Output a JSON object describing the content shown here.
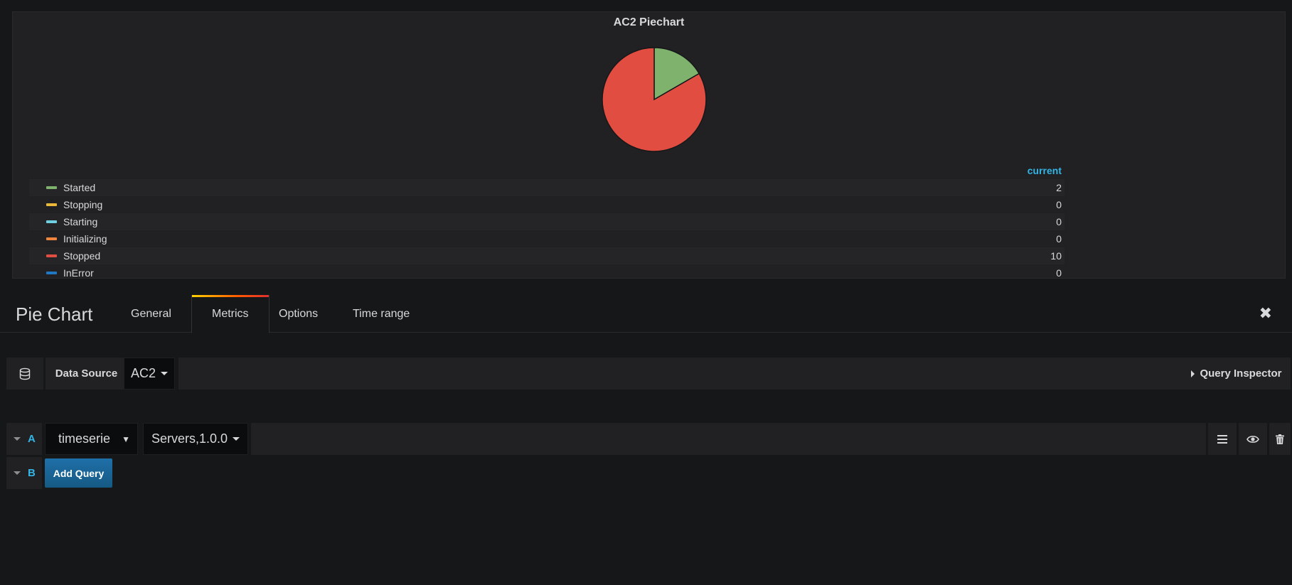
{
  "panel": {
    "title": "AC2 Piechart",
    "legend_header": "current"
  },
  "chart_data": {
    "type": "pie",
    "title": "AC2 Piechart",
    "slices": [
      {
        "name": "Started",
        "value": 2,
        "color": "#7eb26d"
      },
      {
        "name": "Stopping",
        "value": 0,
        "color": "#eab839"
      },
      {
        "name": "Starting",
        "value": 0,
        "color": "#6ed0e0"
      },
      {
        "name": "Initializing",
        "value": 0,
        "color": "#ef843c"
      },
      {
        "name": "Stopped",
        "value": 10,
        "color": "#e24d42"
      },
      {
        "name": "InError",
        "value": 0,
        "color": "#1f78c1"
      }
    ]
  },
  "legend": [
    {
      "label": "Started",
      "value": "2",
      "color": "#7eb26d"
    },
    {
      "label": "Stopping",
      "value": "0",
      "color": "#eab839"
    },
    {
      "label": "Starting",
      "value": "0",
      "color": "#6ed0e0"
    },
    {
      "label": "Initializing",
      "value": "0",
      "color": "#ef843c"
    },
    {
      "label": "Stopped",
      "value": "10",
      "color": "#e24d42"
    },
    {
      "label": "InError",
      "value": "0",
      "color": "#1f78c1"
    }
  ],
  "editor": {
    "title": "Pie Chart",
    "tabs": [
      {
        "label": "General",
        "active": false
      },
      {
        "label": "Metrics",
        "active": true
      },
      {
        "label": "Options",
        "active": false
      },
      {
        "label": "Time range",
        "active": false
      }
    ],
    "close_icon": "close-icon"
  },
  "datasource": {
    "icon": "database-icon",
    "label": "Data Source",
    "selected": "AC2",
    "inspector_label": "Query Inspector"
  },
  "queries": {
    "a": {
      "letter": "A",
      "type": "timeserie",
      "target": "Servers,1.0.0"
    },
    "b": {
      "letter": "B",
      "add_label": "Add Query"
    }
  },
  "colors": {
    "accent": "#33b5e5",
    "add_button": "#1f6fa8"
  }
}
